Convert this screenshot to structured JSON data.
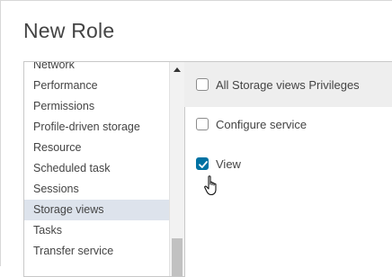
{
  "dialog": {
    "title": "New Role"
  },
  "categories": [
    {
      "label": "Network"
    },
    {
      "label": "Performance"
    },
    {
      "label": "Permissions"
    },
    {
      "label": "Profile-driven storage"
    },
    {
      "label": "Resource"
    },
    {
      "label": "Scheduled task"
    },
    {
      "label": "Sessions"
    },
    {
      "label": "Storage views",
      "selected": true
    },
    {
      "label": "Tasks"
    },
    {
      "label": "Transfer service"
    }
  ],
  "privileges": {
    "all_label": "All Storage views Privileges",
    "all_checked": false,
    "items": [
      {
        "label": "Configure service",
        "checked": false
      },
      {
        "label": "View",
        "checked": true
      }
    ]
  },
  "icons": {
    "scroll_up": "scroll-up-arrow-icon",
    "checkmark": "checkmark-icon",
    "cursor": "hand-pointer-cursor-icon"
  },
  "colors": {
    "checkbox_checked": "#0072a3",
    "selected_row": "#dde3ec",
    "header_row": "#eeeeee"
  }
}
